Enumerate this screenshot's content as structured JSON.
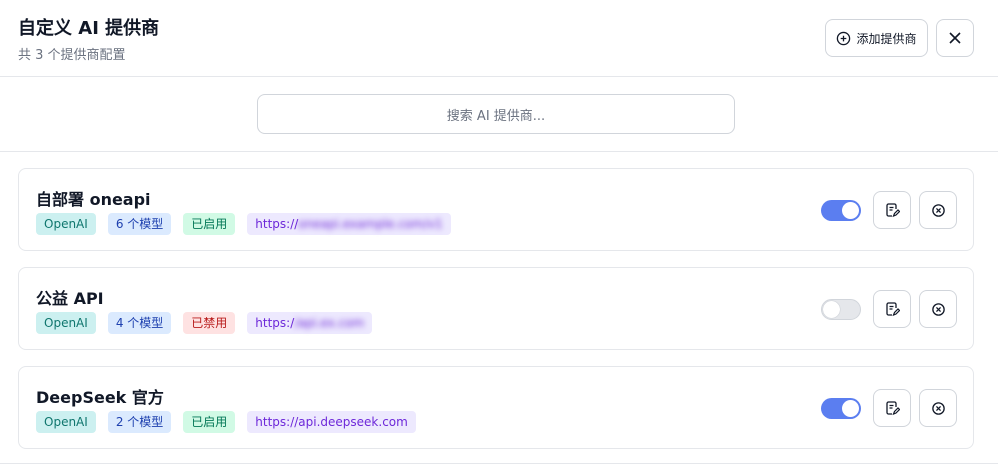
{
  "header": {
    "title": "自定义 AI 提供商",
    "subtitle": "共 3 个提供商配置",
    "add_label": "添加提供商"
  },
  "search": {
    "placeholder": "搜索 AI 提供商..."
  },
  "providers": [
    {
      "name": "自部署 oneapi",
      "type": "OpenAI",
      "models": "6 个模型",
      "status": "已启用",
      "enabled": true,
      "url_prefix": "https://",
      "url_rest": "oneapi.example.com/v1"
    },
    {
      "name": "公益 API",
      "type": "OpenAI",
      "models": "4 个模型",
      "status": "已禁用",
      "enabled": false,
      "url_prefix": "https:/",
      "url_rest": "/api.ex.com"
    },
    {
      "name": "DeepSeek 官方",
      "type": "OpenAI",
      "models": "2 个模型",
      "status": "已启用",
      "enabled": true,
      "url_prefix": "https://api.deepseek.com",
      "url_rest": ""
    }
  ],
  "colors": {
    "accent": "#5b7ef0",
    "enabled_bg": "#d1fae5",
    "disabled_bg": "#fee2e2"
  }
}
